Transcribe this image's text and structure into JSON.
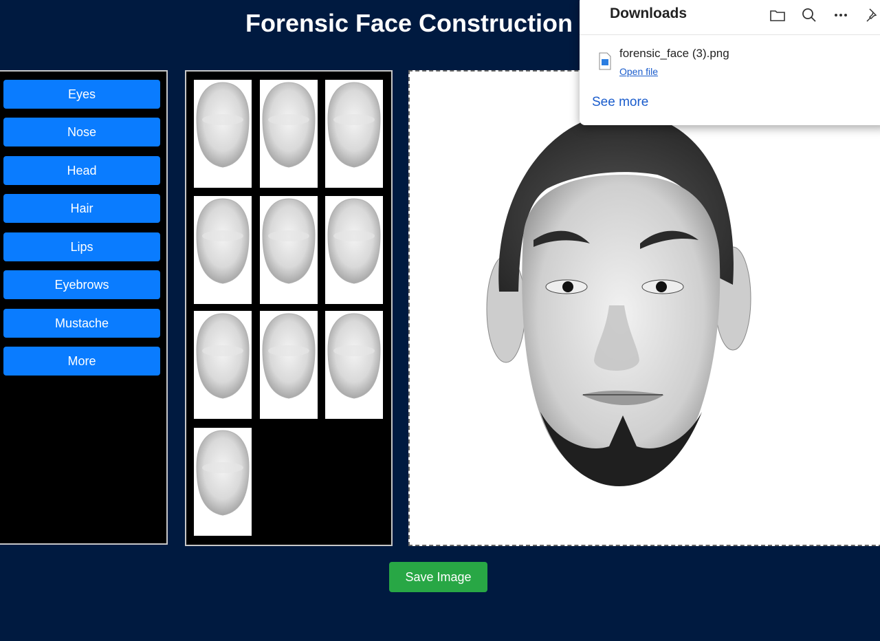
{
  "header": {
    "title": "Forensic Face Construction"
  },
  "categories": [
    {
      "label": "Eyes"
    },
    {
      "label": "Nose"
    },
    {
      "label": "Head"
    },
    {
      "label": "Hair"
    },
    {
      "label": "Lips"
    },
    {
      "label": "Eyebrows"
    },
    {
      "label": "Mustache"
    },
    {
      "label": "More"
    }
  ],
  "thumbnails": {
    "count": 10,
    "kind": "head-shape"
  },
  "actions": {
    "save_label": "Save Image"
  },
  "downloads": {
    "title": "Downloads",
    "icons": [
      "folder-icon",
      "search-icon",
      "more-icon",
      "pin-icon"
    ],
    "file_name": "forensic_face (3).png",
    "open_label": "Open file",
    "see_more_label": "See more"
  },
  "colors": {
    "background": "#001a40",
    "category_button": "#0a7cff",
    "save_button": "#28a745",
    "link": "#1a5ccc"
  }
}
